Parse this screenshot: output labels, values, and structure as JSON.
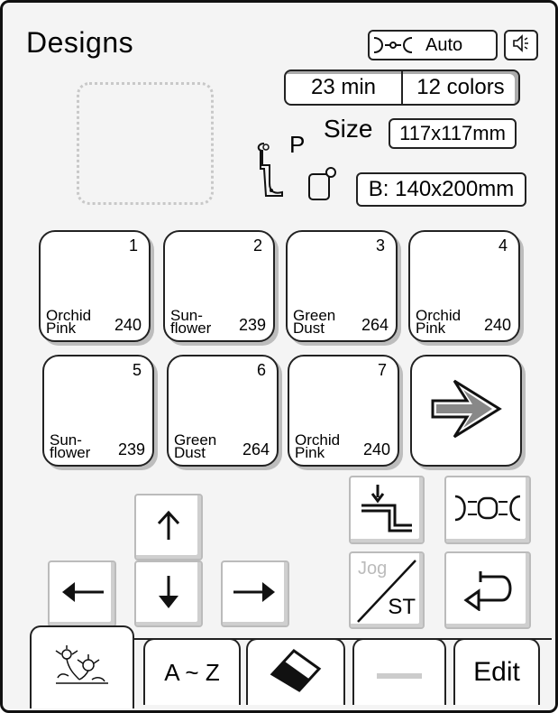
{
  "header": {
    "title": "Designs",
    "auto_label": "Auto",
    "time": "23 min",
    "colors": "12 colors"
  },
  "info": {
    "size_label": "Size",
    "size_value": "117x117mm",
    "foot_letter": "P",
    "hoop_value": "B: 140x200mm"
  },
  "threads": [
    {
      "num": "1",
      "name": "Orchid Pink",
      "code": "240"
    },
    {
      "num": "2",
      "name": "Sun- flower",
      "code": "239"
    },
    {
      "num": "3",
      "name": "Green Dust",
      "code": "264"
    },
    {
      "num": "4",
      "name": "Orchid Pink",
      "code": "240"
    },
    {
      "num": "5",
      "name": "Sun- flower",
      "code": "239"
    },
    {
      "num": "6",
      "name": "Green Dust",
      "code": "264"
    },
    {
      "num": "7",
      "name": "Orchid Pink",
      "code": "240"
    }
  ],
  "controls": {
    "jog_label": "Jog",
    "st_label": "ST"
  },
  "tabs": {
    "az_label": "A ~ Z",
    "edit_label": "Edit"
  },
  "icons": {
    "auto": "hoop-icon",
    "sound": "speaker-icon",
    "next": "next-arrow-icon",
    "needle_down": "needle-position-icon",
    "hoop_move": "hoop-move-icon",
    "return": "return-arrow-icon",
    "flowers": "flowers-icon",
    "eraser": "eraser-icon"
  }
}
